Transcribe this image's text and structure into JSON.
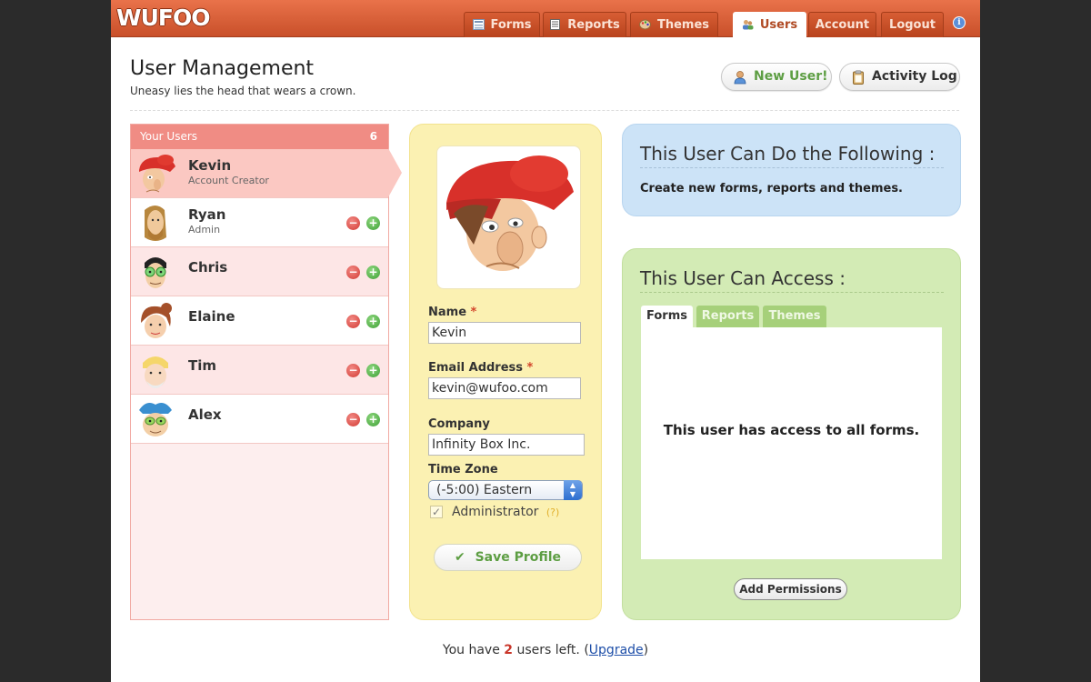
{
  "app": {
    "logo": "WUFOO"
  },
  "nav": {
    "tabs": [
      {
        "label": "Forms",
        "icon": "forms-icon"
      },
      {
        "label": "Reports",
        "icon": "reports-icon"
      },
      {
        "label": "Themes",
        "icon": "themes-icon"
      },
      {
        "label": "Users",
        "icon": "users-icon",
        "active": true
      },
      {
        "label": "Account"
      },
      {
        "label": "Logout"
      }
    ],
    "info_icon": "i"
  },
  "header": {
    "title": "User Management",
    "subtitle": "Uneasy lies the head that wears a crown.",
    "new_user_label": "New User!",
    "activity_log_label": "Activity Log"
  },
  "users": {
    "heading": "Your Users",
    "count": "6",
    "list": [
      {
        "name": "Kevin",
        "role": "Account Creator",
        "selected": true
      },
      {
        "name": "Ryan",
        "role": "Admin"
      },
      {
        "name": "Chris",
        "role": ""
      },
      {
        "name": "Elaine",
        "role": ""
      },
      {
        "name": "Tim",
        "role": ""
      },
      {
        "name": "Alex",
        "role": ""
      }
    ],
    "minus_symbol": "−",
    "plus_symbol": "+"
  },
  "profile": {
    "name_label": "Name",
    "name_value": "Kevin",
    "email_label": "Email Address",
    "email_value": "kevin@wufoo.com",
    "company_label": "Company",
    "company_value": "Infinity Box Inc.",
    "timezone_label": "Time Zone",
    "timezone_value": "(-5:00) Eastern",
    "required_mark": "*",
    "admin_label": "Administrator",
    "admin_help": "(?)",
    "admin_checked": true,
    "check_mark": "✓",
    "save_label": "Save Profile",
    "save_icon": "✔"
  },
  "permissions": {
    "title": "This User Can Do the Following :",
    "text": "Create new forms, reports and themes."
  },
  "access": {
    "title": "This User Can Access :",
    "tabs": [
      "Forms",
      "Reports",
      "Themes"
    ],
    "message": "This user has access to all forms.",
    "add_button": "Add Permissions"
  },
  "footer": {
    "prefix": "You have ",
    "count": "2",
    "middle": " users left. (",
    "link": "Upgrade",
    "suffix": ")"
  },
  "colors": {
    "topbar": "#d75d34",
    "users_header": "#f08c84",
    "profile_panel": "#fbf1b2",
    "permissions_panel": "#cce3f7",
    "access_panel": "#d3ebb5"
  }
}
